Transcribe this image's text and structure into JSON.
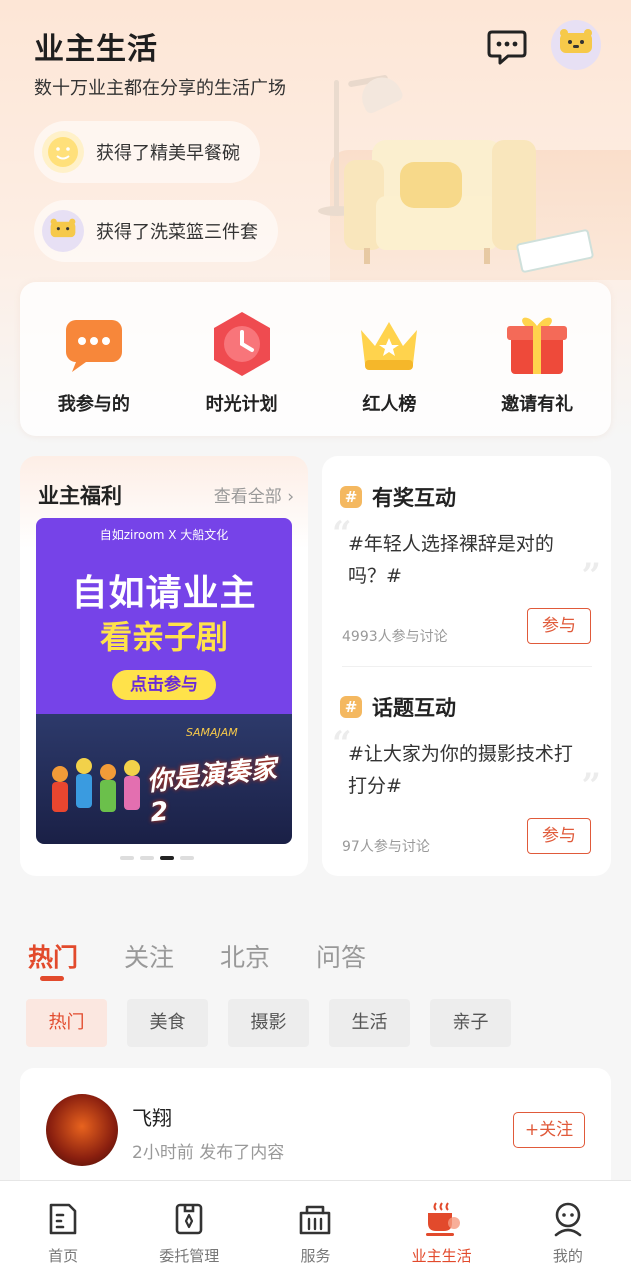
{
  "header": {
    "title": "业主生活",
    "subtitle": "数十万业主都在分享的生活广场",
    "message_icon": "chat-bubble-icon",
    "avatar_text": "ZIROOM"
  },
  "feed_ticker": [
    {
      "text": "获得了精美早餐碗",
      "icon": "smiley-avatar-icon"
    },
    {
      "text": "获得了洗菜篮三件套",
      "icon": "ziroom-bear-avatar-icon"
    }
  ],
  "quick_actions": [
    {
      "label": "我参与的",
      "icon": "chat-dots-icon"
    },
    {
      "label": "时光计划",
      "icon": "clock-hexagon-icon"
    },
    {
      "label": "红人榜",
      "icon": "crown-icon"
    },
    {
      "label": "邀请有礼",
      "icon": "gift-box-icon"
    }
  ],
  "welfare": {
    "title": "业主福利",
    "view_all": "查看全部 ›",
    "banner": {
      "brand": "自如ziroom  X  大船文化",
      "line1": "自如请业主",
      "line2": "看亲子剧",
      "cta": "点击参与",
      "show_title": "你是演奏家2",
      "show_sub": "SAMAJAM"
    },
    "carousel_total": 4,
    "carousel_active": 3
  },
  "topics": [
    {
      "title": "有奖互动",
      "text": "#年轻人选择裸辞是对的吗？#",
      "count": "4993人参与讨论",
      "action": "参与"
    },
    {
      "title": "话题互动",
      "text": "#让大家为你的摄影技术打打分#",
      "count": "97人参与讨论",
      "action": "参与"
    }
  ],
  "feed_tabs": [
    {
      "label": "热门",
      "active": true
    },
    {
      "label": "关注",
      "active": false
    },
    {
      "label": "北京",
      "active": false
    },
    {
      "label": "问答",
      "active": false
    }
  ],
  "chips": [
    {
      "label": "热门",
      "active": true
    },
    {
      "label": "美食",
      "active": false
    },
    {
      "label": "摄影",
      "active": false
    },
    {
      "label": "生活",
      "active": false
    },
    {
      "label": "亲子",
      "active": false
    }
  ],
  "post": {
    "author": "飞翔",
    "meta": "2小时前 发布了内容",
    "follow": "+关注"
  },
  "tabbar": [
    {
      "label": "首页",
      "icon": "home-icon",
      "active": false
    },
    {
      "label": "委托管理",
      "icon": "clipboard-icon",
      "active": false
    },
    {
      "label": "服务",
      "icon": "service-icon",
      "active": false
    },
    {
      "label": "业主生活",
      "icon": "coffee-cup-icon",
      "active": true
    },
    {
      "label": "我的",
      "icon": "profile-icon",
      "active": false
    }
  ],
  "colors": {
    "accent": "#e24a2c",
    "welfare_banner_purple": "#7643e8",
    "banner_yellow": "#ffe24a"
  }
}
